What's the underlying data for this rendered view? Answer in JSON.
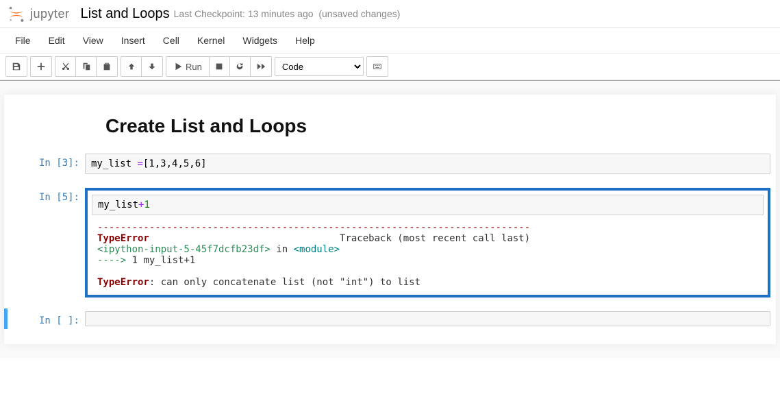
{
  "header": {
    "logo_text": "jupyter",
    "title": "List and Loops",
    "checkpoint": "Last Checkpoint: 13 minutes ago",
    "unsaved": "(unsaved changes)"
  },
  "menubar": [
    "File",
    "Edit",
    "View",
    "Insert",
    "Cell",
    "Kernel",
    "Widgets",
    "Help"
  ],
  "toolbar": {
    "run_label": "Run",
    "cell_type_value": "Code"
  },
  "notebook": {
    "heading": "Create List and Loops",
    "cells": [
      {
        "prompt": "In [3]:",
        "code_prefix": "my_list ",
        "code_op": "=",
        "code_list": "[1,3,4,5,6]"
      },
      {
        "prompt": "In [5]:",
        "code_var": "my_list",
        "code_op": "+",
        "code_num": "1",
        "error": {
          "dashes": "---------------------------------------------------------------------------",
          "type": "TypeError",
          "traceback_label": "Traceback (most recent call last)",
          "source_ref": "<ipython-input-5-45f7dcfb23df>",
          "in_word": " in ",
          "module": "<module>",
          "arrow": "----> ",
          "lineno": "1",
          "err_code": " my_list+1",
          "final_type": "TypeError",
          "final_msg": ": can only concatenate list (not \"int\") to list"
        }
      },
      {
        "prompt": "In [ ]:",
        "code": ""
      }
    ]
  }
}
